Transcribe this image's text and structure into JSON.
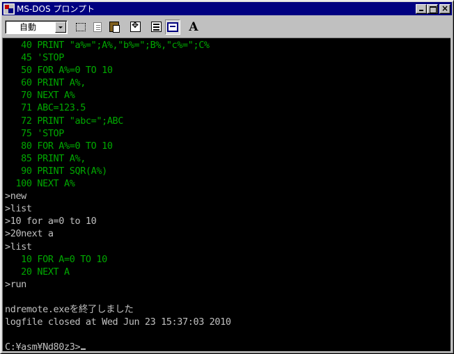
{
  "window": {
    "title": "MS-DOS プロンプト"
  },
  "toolbar": {
    "font_size_value": "自動",
    "font_button_label": "A"
  },
  "console": {
    "lines": [
      {
        "text": "   40 PRINT \"a%=\";A%,\"b%=\";B%,\"c%=\";C%",
        "color": "green"
      },
      {
        "text": "   45 'STOP",
        "color": "green"
      },
      {
        "text": "   50 FOR A%=0 TO 10",
        "color": "green"
      },
      {
        "text": "   60 PRINT A%,",
        "color": "green"
      },
      {
        "text": "   70 NEXT A%",
        "color": "green"
      },
      {
        "text": "   71 ABC=123.5",
        "color": "green"
      },
      {
        "text": "   72 PRINT \"abc=\";ABC",
        "color": "green"
      },
      {
        "text": "   75 'STOP",
        "color": "green"
      },
      {
        "text": "   80 FOR A%=0 TO 10",
        "color": "green"
      },
      {
        "text": "   85 PRINT A%,",
        "color": "green"
      },
      {
        "text": "   90 PRINT SQR(A%)",
        "color": "green"
      },
      {
        "text": "  100 NEXT A%",
        "color": "green"
      },
      {
        "text": ">new",
        "color": "white"
      },
      {
        "text": ">list",
        "color": "white"
      },
      {
        "text": ">10 for a=0 to 10",
        "color": "white"
      },
      {
        "text": ">20next a",
        "color": "white"
      },
      {
        "text": ">list",
        "color": "white"
      },
      {
        "text": "   10 FOR A=0 TO 10",
        "color": "green"
      },
      {
        "text": "   20 NEXT A",
        "color": "green"
      },
      {
        "text": ">run",
        "color": "white"
      },
      {
        "text": "",
        "color": "white"
      },
      {
        "text": "ndremote.exeを終了しました",
        "color": "white"
      },
      {
        "text": "logfile closed at Wed Jun 23 15:37:03 2010",
        "color": "white"
      },
      {
        "text": "",
        "color": "white"
      },
      {
        "text": "C:¥asm¥Nd80z3>",
        "color": "white"
      }
    ]
  },
  "colors": {
    "title_bar": "#000080",
    "console_bg": "#000000",
    "console_green": "#00a800",
    "console_white": "#c0c0c0"
  },
  "icons": [
    "ms-dos-icon",
    "minimize-icon",
    "maximize-icon",
    "close-icon",
    "mark-icon",
    "copy-icon",
    "paste-icon",
    "full-screen-icon",
    "properties-icon",
    "background-icon",
    "font-icon"
  ]
}
